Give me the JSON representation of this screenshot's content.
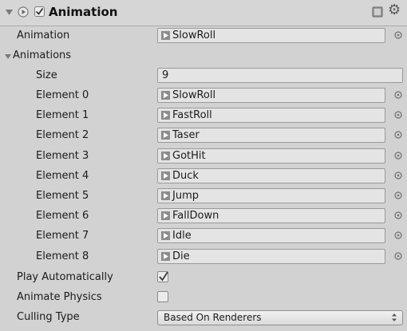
{
  "component": {
    "title": "Animation",
    "enabled": true,
    "icons": [
      "fold-arrow-icon",
      "component-circle-icon",
      "checkbox-icon",
      "help-book-icon",
      "gear-icon"
    ]
  },
  "animation_field": {
    "label": "Animation",
    "value": "SlowRoll"
  },
  "animations": {
    "label": "Animations",
    "size_label": "Size",
    "size_value": "9",
    "elements": [
      {
        "label": "Element 0",
        "value": "SlowRoll"
      },
      {
        "label": "Element 1",
        "value": "FastRoll"
      },
      {
        "label": "Element 2",
        "value": "Taser"
      },
      {
        "label": "Element 3",
        "value": "GotHit"
      },
      {
        "label": "Element 4",
        "value": "Duck"
      },
      {
        "label": "Element 5",
        "value": "Jump"
      },
      {
        "label": "Element 6",
        "value": "FallDown"
      },
      {
        "label": "Element 7",
        "value": "Idle"
      },
      {
        "label": "Element 8",
        "value": "Die"
      }
    ]
  },
  "play_automatically": {
    "label": "Play Automatically",
    "checked": true
  },
  "animate_physics": {
    "label": "Animate Physics",
    "checked": false
  },
  "culling_type": {
    "label": "Culling Type",
    "value": "Based On Renderers"
  }
}
